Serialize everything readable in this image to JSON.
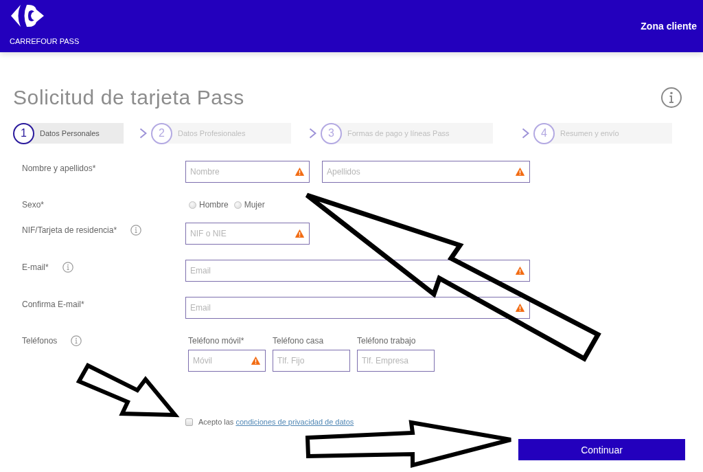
{
  "header": {
    "brand": "CARREFOUR PASS",
    "link": "Zona cliente"
  },
  "title": "Solicitud de tarjeta Pass",
  "steps": [
    {
      "number": "1",
      "label": "Datos Personales",
      "selected": true
    },
    {
      "number": "2",
      "label": "Datos Profesionales",
      "selected": false
    },
    {
      "number": "3",
      "label": "Formas de pago y líneas Pass",
      "selected": false
    },
    {
      "number": "4",
      "label": "Resumen y envío",
      "selected": false
    }
  ],
  "form": [
    {
      "kind": "pair",
      "label": "Nombre y apellidos*",
      "info": false,
      "fields": [
        {
          "placeholder": "Nombre",
          "warning": true
        },
        {
          "placeholder": "Apellidos",
          "warning": true
        }
      ]
    },
    {
      "kind": "radio",
      "label": "Sexo*",
      "info": false,
      "options": [
        {
          "label": "Hombre",
          "selected": false
        },
        {
          "label": "Mujer",
          "selected": false
        }
      ]
    },
    {
      "kind": "short",
      "label": "NIF/Tarjeta de residencia*",
      "info": true,
      "fields": [
        {
          "placeholder": "NIF o NIE",
          "warning": true
        }
      ]
    },
    {
      "kind": "wide",
      "label": "E-mail*",
      "info": true,
      "fields": [
        {
          "placeholder": "Email",
          "warning": true
        }
      ]
    },
    {
      "kind": "wide",
      "label": "Confirma E-mail*",
      "info": false,
      "fields": [
        {
          "placeholder": "Email",
          "warning": true
        }
      ]
    },
    {
      "kind": "phones",
      "label": "Teléfonos",
      "info": true,
      "fields": [
        {
          "label": "Teléfono móvil*",
          "placeholder": "Móvil",
          "warning": true
        },
        {
          "label": "Teléfono casa",
          "placeholder": "Tlf. Fijo",
          "warning": false
        },
        {
          "label": "Teléfono trabajo",
          "placeholder": "Tlf. Empresa",
          "warning": false
        }
      ]
    }
  ],
  "consent": {
    "checked": false,
    "text": "Acepto las",
    "link": "condiciones de privacidad de datos"
  },
  "button": "Continuar"
}
